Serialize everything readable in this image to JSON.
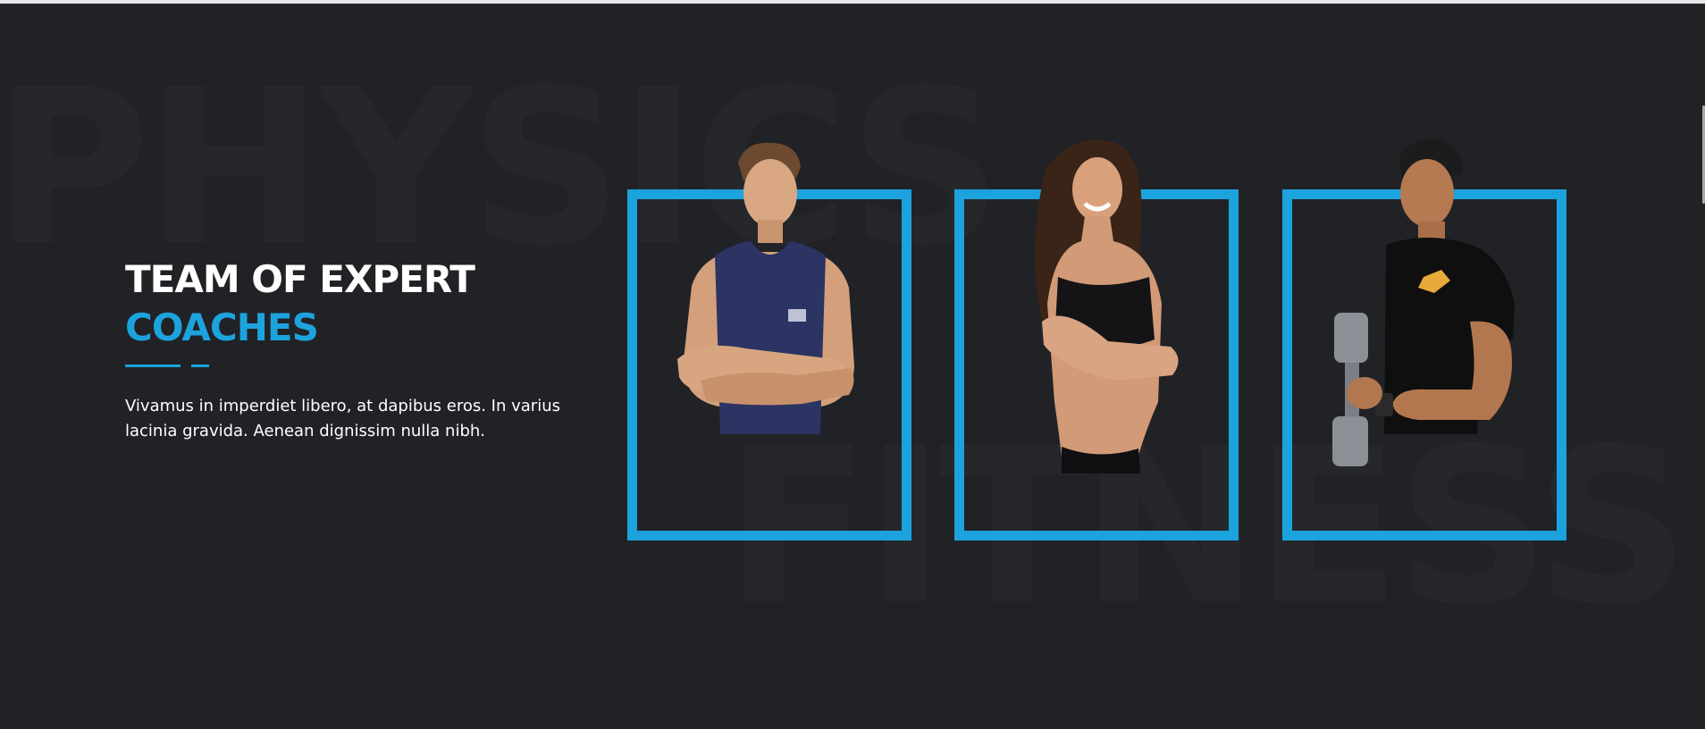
{
  "background": {
    "watermark_top": "PHYSICS",
    "watermark_bottom": "FITNESS"
  },
  "intro": {
    "title_line1": "TEAM OF EXPERT",
    "title_line2": "COACHES",
    "description": "Vivamus in imperdiet libero, at dapibus eros. In varius lacinia gravida. Aenean dignissim nulla nibh."
  },
  "coaches": [
    {
      "figure": "man-crossed-arms-navy-tank"
    },
    {
      "figure": "woman-crossed-arms-black-top"
    },
    {
      "figure": "man-dumbbell-black-tee"
    }
  ],
  "colors": {
    "accent": "#1ca3de",
    "background": "#212226",
    "text": "#ffffff"
  }
}
